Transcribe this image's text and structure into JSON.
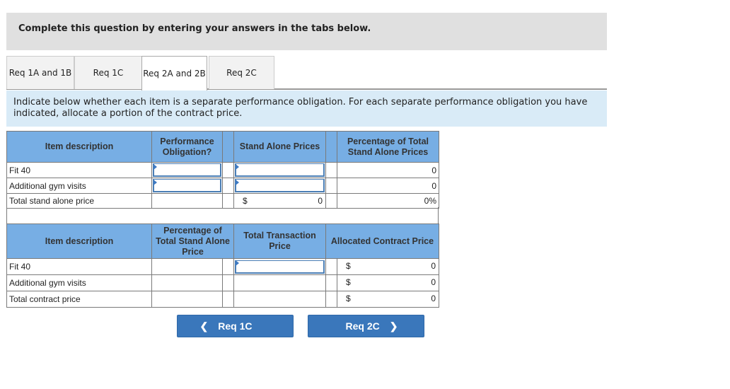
{
  "instruction": "Complete this question by entering your answers in the tabs below.",
  "tabs": [
    {
      "label": "Req 1A and 1B",
      "active": false
    },
    {
      "label": "Req 1C",
      "active": false
    },
    {
      "label": "Req 2A and 2B",
      "active": true
    },
    {
      "label": "Req 2C",
      "active": false
    }
  ],
  "description": "Indicate below whether each item is a separate performance obligation. For each separate performance obligation you have indicated, allocate a portion of the contract price.",
  "table1": {
    "headers": {
      "item": "Item description",
      "obligation": "Performance Obligation?",
      "stand_alone": "Stand Alone Prices",
      "percentage": "Percentage of Total Stand Alone Prices"
    },
    "rows": [
      {
        "item": "Fit 40",
        "obligation": "",
        "stand_alone": "",
        "percentage": "0"
      },
      {
        "item": "Additional gym visits",
        "obligation": "",
        "stand_alone": "",
        "percentage": "0"
      }
    ],
    "total": {
      "item": "Total stand alone price",
      "currency": "$",
      "stand_alone": "0",
      "percentage": "0%"
    }
  },
  "table2": {
    "headers": {
      "item": "Item description",
      "percentage": "Percentage of Total Stand Alone Price",
      "transaction": "Total Transaction Price",
      "allocated": "Allocated Contract Price"
    },
    "rows": [
      {
        "item": "Fit 40",
        "percentage": "",
        "transaction": "",
        "currency": "$",
        "allocated": "0"
      },
      {
        "item": "Additional gym visits",
        "percentage": "",
        "transaction": "",
        "currency": "$",
        "allocated": "0"
      }
    ],
    "total": {
      "item": "Total contract price",
      "currency": "$",
      "allocated": "0"
    }
  },
  "nav": {
    "prev_label": "Req 1C",
    "next_label": "Req 2C",
    "prev_icon": "chevron-left-icon",
    "next_icon": "chevron-right-icon"
  }
}
